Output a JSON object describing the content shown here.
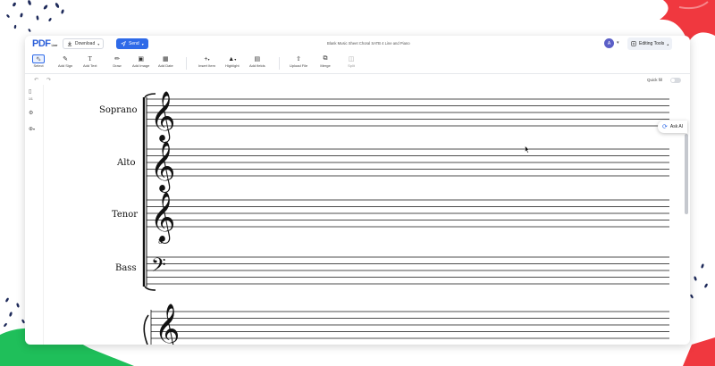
{
  "app": {
    "logo_text": "PDF",
    "logo_sub": "Liner",
    "document_title": "Blank Music Sheet Choral SATB 4 Line and Piano"
  },
  "topbar": {
    "download_label": "Download",
    "send_label": "Send",
    "avatar_initial": "A",
    "editing_tools_label": "Editing Tools"
  },
  "toolbar": {
    "tools": [
      {
        "label": "Select",
        "icon": "select-icon"
      },
      {
        "label": "Add Sign",
        "icon": "sign-icon"
      },
      {
        "label": "Add Text",
        "icon": "text-icon"
      },
      {
        "label": "Draw",
        "icon": "draw-icon"
      },
      {
        "label": "Add Image",
        "icon": "image-icon"
      },
      {
        "label": "Add Date",
        "icon": "calendar-icon"
      },
      {
        "label": "Insert Item",
        "icon": "plus-icon"
      },
      {
        "label": "Highlight",
        "icon": "highlight-icon"
      },
      {
        "label": "Add fields",
        "icon": "fields-icon"
      },
      {
        "label": "Upload File",
        "icon": "upload-icon"
      },
      {
        "label": "Merge",
        "icon": "merge-icon"
      },
      {
        "label": "Split",
        "icon": "split-icon"
      }
    ]
  },
  "subbar": {
    "quick_fill_label": "Quick fill",
    "quick_fill_on": false
  },
  "leftpanel": {
    "page_count": "1/1"
  },
  "ask_ai_label": "Ask AI",
  "sheet": {
    "staff_labels": [
      "Soprano",
      "Alto",
      "Tenor",
      "Bass"
    ]
  },
  "colors": {
    "accent": "#2f6ae8",
    "avatar": "#5b5fc7",
    "deco_red": "#f0383f",
    "deco_green": "#1fbf5a",
    "deco_navy": "#1e2a5a"
  }
}
